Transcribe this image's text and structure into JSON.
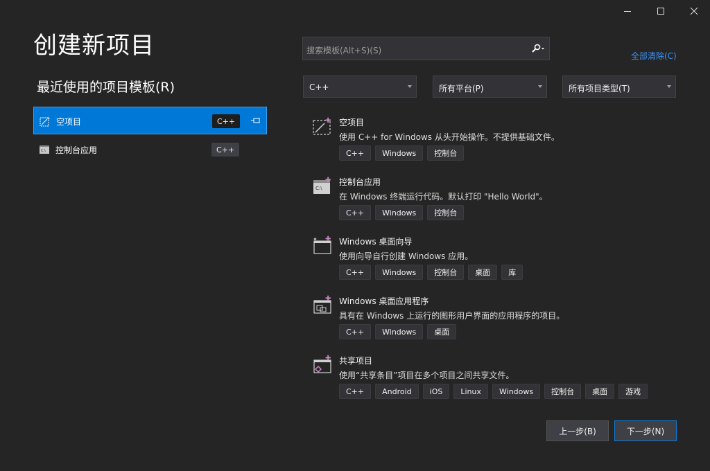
{
  "window": {
    "controls": {
      "minimize": "minimize-icon",
      "maximize": "maximize-icon",
      "close": "close-icon"
    }
  },
  "page": {
    "title": "创建新项目"
  },
  "recent": {
    "title": "最近使用的项目模板(R)",
    "items": [
      {
        "label": "空项目",
        "lang": "C++",
        "pinned": true,
        "selected": true,
        "icon": "empty-project-icon"
      },
      {
        "label": "控制台应用",
        "lang": "C++",
        "pinned": false,
        "selected": false,
        "icon": "console-app-icon"
      }
    ]
  },
  "search": {
    "placeholder": "搜索模板(Alt+S)(S)",
    "icon": "search-icon"
  },
  "clear_all": "全部清除(C)",
  "filters": [
    {
      "label": "C++"
    },
    {
      "label": "所有平台(P)"
    },
    {
      "label": "所有项目类型(T)"
    }
  ],
  "templates": [
    {
      "name": "空项目",
      "desc": "使用 C++ for Windows 从头开始操作。不提供基础文件。",
      "tags": [
        "C++",
        "Windows",
        "控制台"
      ],
      "icon": "empty-project-icon"
    },
    {
      "name": "控制台应用",
      "desc": "在 Windows 终端运行代码。默认打印 \"Hello World\"。",
      "tags": [
        "C++",
        "Windows",
        "控制台"
      ],
      "icon": "console-app-icon"
    },
    {
      "name": "Windows 桌面向导",
      "desc": "使用向导自行创建 Windows 应用。",
      "tags": [
        "C++",
        "Windows",
        "控制台",
        "桌面",
        "库"
      ],
      "icon": "wizard-icon"
    },
    {
      "name": "Windows 桌面应用程序",
      "desc": "具有在 Windows 上运行的图形用户界面的应用程序的项目。",
      "tags": [
        "C++",
        "Windows",
        "桌面"
      ],
      "icon": "desktop-app-icon"
    },
    {
      "name": "共享项目",
      "desc": "使用“共享条目”项目在多个项目之间共享文件。",
      "tags": [
        "C++",
        "Android",
        "iOS",
        "Linux",
        "Windows",
        "控制台",
        "桌面",
        "游戏"
      ],
      "icon": "shared-project-icon"
    }
  ],
  "buttons": {
    "back": "上一步(B)",
    "next": "下一步(N)"
  },
  "colors": {
    "background": "#252526",
    "accent": "#0078d7",
    "link": "#3794ff"
  }
}
